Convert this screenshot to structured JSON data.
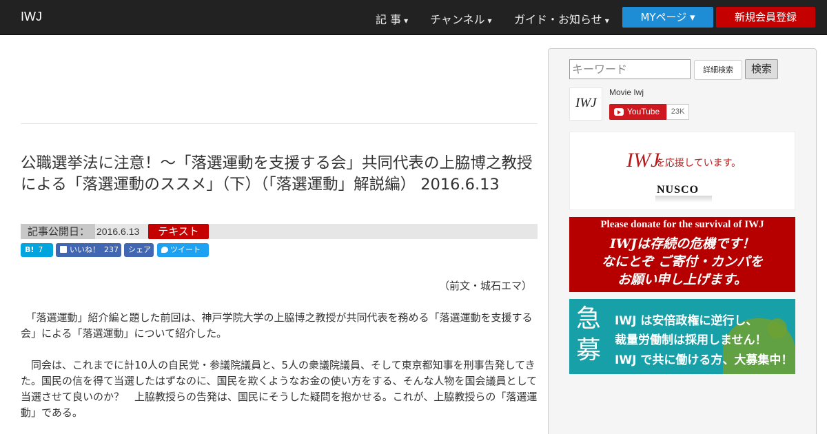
{
  "navbar": {
    "brand": "IWJ",
    "items": [
      {
        "label": "記 事",
        "caret": "▾"
      },
      {
        "label": "チャンネル",
        "caret": "▾"
      },
      {
        "label": "ガイド・お知らせ",
        "caret": "▾"
      }
    ],
    "mypage_label": "MYページ ▾",
    "register_label": "新規会員登録"
  },
  "article": {
    "title": "公職選挙法に注意！～「落選運動を支援する会」共同代表の上脇博之教授による「落選運動のススメ」（下）（「落選運動」解説編） 2016.6.13",
    "meta_label": "記事公開日：",
    "meta_date": "2016.6.13",
    "meta_badge": "テキスト",
    "share": {
      "hatena_label": "B!",
      "hatena_count": "7",
      "like_label": "いいね！",
      "like_count": "237",
      "fb_share_label": "シェア",
      "tweet_label": "ツイート"
    },
    "byline": "（前文・城石エマ）",
    "paragraphs": [
      "　「落選運動」紹介編と題した前回は、神戸学院大学の上脇博之教授が共同代表を務める「落選運動を支援する会」による「落選運動」について紹介した。",
      "　同会は、これまでに計10人の自民党・参議院議員と、5人の衆議院議員、そして東京都知事を刑事告発してきた。国民の信を得て当選したはずなのに、国民を欺くようなお金の使い方をする、そんな人物を国会議員として当選させて良いのか？　上脇教授らの告発は、国民にそうした疑問を抱かせる。これが、上脇教授らの「落選運動」である。"
    ]
  },
  "sidebar": {
    "search": {
      "placeholder": "キーワード",
      "detail_label": "詳細検索",
      "submit_label": "検索"
    },
    "youtube": {
      "logo_text": "IWJ",
      "channel_name": "Movie Iwj",
      "button_label": "YouTube",
      "subscriber_count": "23K"
    },
    "banners": {
      "nusco": {
        "iwj": "IWJ",
        "text": "を応援しています。",
        "brand": "NUSCO"
      },
      "donate": {
        "english": "Please donate for the survival of IWJ",
        "lines": [
          "IWJは存続の危機です！",
          "なにとぞ ご寄付・カンパを",
          "お願い申し上げます。"
        ]
      },
      "recruit": {
        "big_chars": [
          "急",
          "募"
        ],
        "lines": [
          "IWJ は安倍政権に逆行し、",
          "裁量労働制は採用しません！",
          "IWJ で共に働ける方、大募集中！"
        ]
      }
    }
  },
  "colors": {
    "navbar_bg": "#222222",
    "mypage": "#1f8dd6",
    "register": "#c40000",
    "badge": "#c40000",
    "hatena": "#00a4de",
    "facebook": "#4267b2",
    "twitter": "#1da1f2",
    "donate_bg": "#b60000",
    "recruit_bg": "#17a0a8"
  }
}
